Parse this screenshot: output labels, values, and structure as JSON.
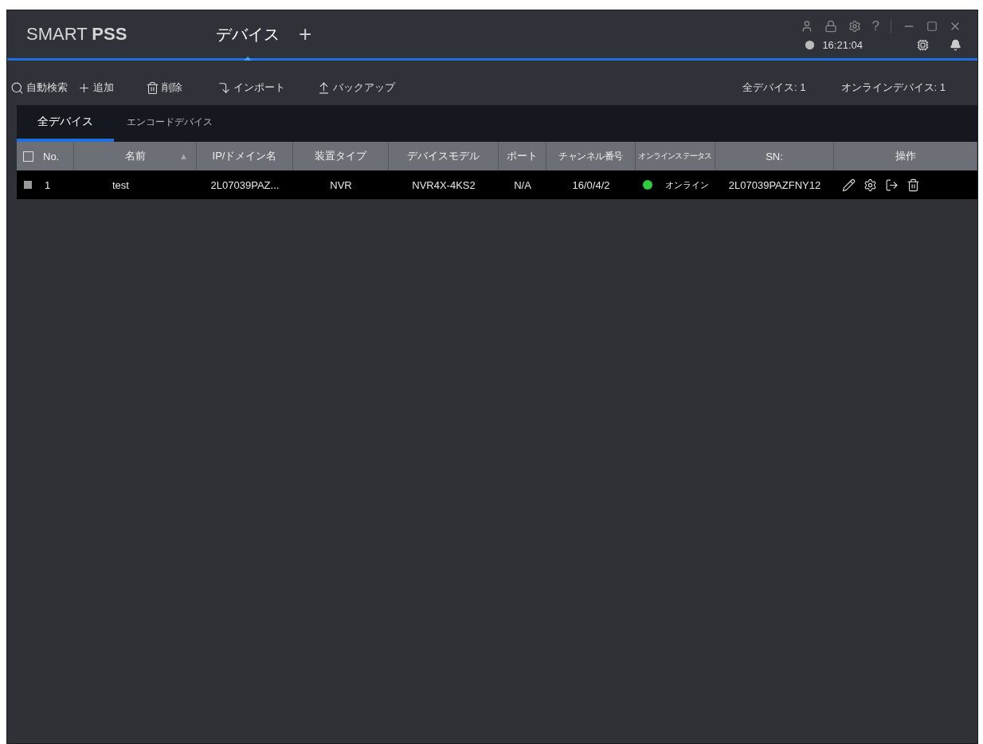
{
  "app": {
    "logo_light": "SMART ",
    "logo_bold": "PSS"
  },
  "top_tabs": [
    {
      "label": "デバイス",
      "selected": true
    }
  ],
  "add_tab": "+",
  "help": "?",
  "clock": "16:21:04",
  "toolbar": [
    {
      "kind": "search",
      "label": "自動検索"
    },
    {
      "kind": "add",
      "label": "追加"
    },
    {
      "kind": "delete",
      "label": "削除"
    },
    {
      "kind": "import",
      "label": "インポート"
    },
    {
      "kind": "backup",
      "label": "バックアップ"
    }
  ],
  "counts": [
    {
      "label": "全デバイス:",
      "value": "1"
    },
    {
      "label": "オンラインデバイス:",
      "value": "1"
    }
  ],
  "tabs": [
    {
      "label": "全デバイス",
      "selected": true
    },
    {
      "label": "エンコードデバイス",
      "selected": false
    }
  ],
  "table": {
    "select_all_checked": false,
    "columns": [
      {
        "label": "No."
      },
      {
        "label": "名前",
        "sort": "▲"
      },
      {
        "label": "IP/ドメイン名"
      },
      {
        "label": "装置タイプ"
      },
      {
        "label": "デバイスモデル"
      },
      {
        "label": "ポート"
      },
      {
        "label": "チャンネル番号"
      },
      {
        "label": "オンラインステータス"
      },
      {
        "label": "SN:"
      },
      {
        "label": "操作"
      }
    ],
    "rows": [
      {
        "checked": false,
        "no": "1",
        "name": "test",
        "ip": "2L07039PAZ...",
        "type": "NVR",
        "model": "NVR4X-4KS2",
        "port": "N/A",
        "channels": "16/0/4/2",
        "color": "#2ecc40",
        "status": "オンライン",
        "sn": "2L07039PAZFNY12"
      }
    ]
  }
}
